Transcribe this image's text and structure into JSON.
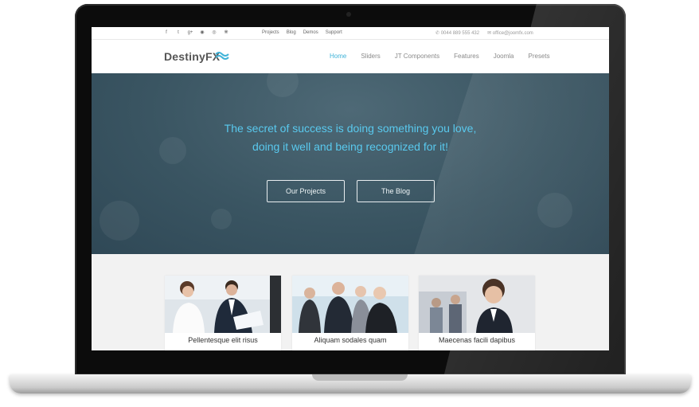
{
  "topbar": {
    "social_icons": [
      "facebook-icon",
      "twitter-icon",
      "google-plus-icon",
      "rss-icon",
      "dribbble-icon",
      "github-icon"
    ],
    "social_glyphs": [
      "f",
      "t",
      "g+",
      "◉",
      "◎",
      "❋"
    ],
    "links": [
      "Projects",
      "Blog",
      "Demos",
      "Support"
    ],
    "phone": "0044 889 555 432",
    "email": "office@joomfx.com"
  },
  "header": {
    "logo": "DestinyFX",
    "nav": [
      "Home",
      "Sliders",
      "JT Components",
      "Features",
      "Joomla",
      "Presets"
    ],
    "active": "Home"
  },
  "hero": {
    "tagline_line1": "The secret of success is doing something you love,",
    "tagline_line2": "doing it well and being recognized for it!",
    "button_projects": "Our Projects",
    "button_blog": "The Blog"
  },
  "cards": [
    {
      "caption": "Pellentesque elit risus"
    },
    {
      "caption": "Aliquam sodales quam"
    },
    {
      "caption": "Maecenas facili dapibus"
    }
  ],
  "colors": {
    "accent": "#3fb3d8",
    "tagline": "#59c9ee",
    "hero_bg": "#3a5562"
  }
}
